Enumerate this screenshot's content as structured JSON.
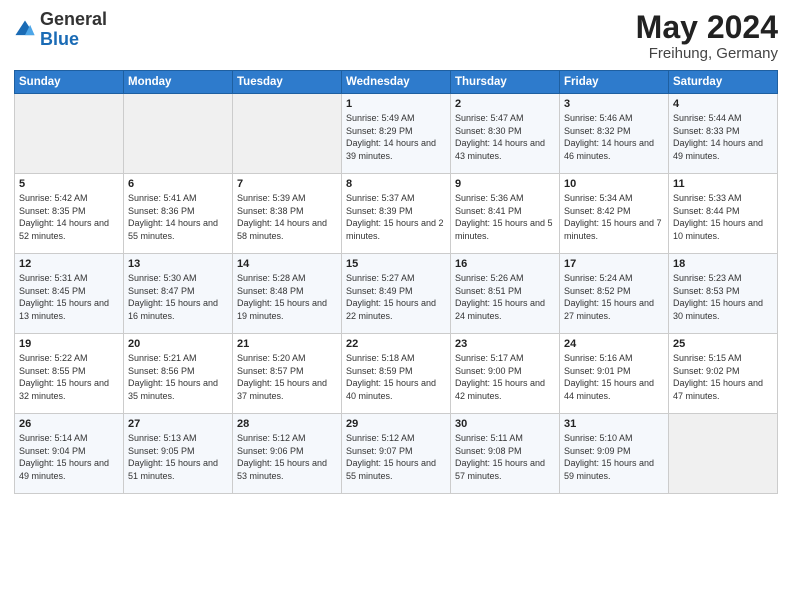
{
  "header": {
    "logo_general": "General",
    "logo_blue": "Blue",
    "title": "May 2024",
    "subtitle": "Freihung, Germany"
  },
  "days_of_week": [
    "Sunday",
    "Monday",
    "Tuesday",
    "Wednesday",
    "Thursday",
    "Friday",
    "Saturday"
  ],
  "weeks": [
    [
      {
        "day": "",
        "empty": true
      },
      {
        "day": "",
        "empty": true
      },
      {
        "day": "",
        "empty": true
      },
      {
        "day": "1",
        "sunrise": "5:49 AM",
        "sunset": "8:29 PM",
        "daylight": "14 hours and 39 minutes."
      },
      {
        "day": "2",
        "sunrise": "5:47 AM",
        "sunset": "8:30 PM",
        "daylight": "14 hours and 43 minutes."
      },
      {
        "day": "3",
        "sunrise": "5:46 AM",
        "sunset": "8:32 PM",
        "daylight": "14 hours and 46 minutes."
      },
      {
        "day": "4",
        "sunrise": "5:44 AM",
        "sunset": "8:33 PM",
        "daylight": "14 hours and 49 minutes."
      }
    ],
    [
      {
        "day": "5",
        "sunrise": "5:42 AM",
        "sunset": "8:35 PM",
        "daylight": "14 hours and 52 minutes."
      },
      {
        "day": "6",
        "sunrise": "5:41 AM",
        "sunset": "8:36 PM",
        "daylight": "14 hours and 55 minutes."
      },
      {
        "day": "7",
        "sunrise": "5:39 AM",
        "sunset": "8:38 PM",
        "daylight": "14 hours and 58 minutes."
      },
      {
        "day": "8",
        "sunrise": "5:37 AM",
        "sunset": "8:39 PM",
        "daylight": "15 hours and 2 minutes."
      },
      {
        "day": "9",
        "sunrise": "5:36 AM",
        "sunset": "8:41 PM",
        "daylight": "15 hours and 5 minutes."
      },
      {
        "day": "10",
        "sunrise": "5:34 AM",
        "sunset": "8:42 PM",
        "daylight": "15 hours and 7 minutes."
      },
      {
        "day": "11",
        "sunrise": "5:33 AM",
        "sunset": "8:44 PM",
        "daylight": "15 hours and 10 minutes."
      }
    ],
    [
      {
        "day": "12",
        "sunrise": "5:31 AM",
        "sunset": "8:45 PM",
        "daylight": "15 hours and 13 minutes."
      },
      {
        "day": "13",
        "sunrise": "5:30 AM",
        "sunset": "8:47 PM",
        "daylight": "15 hours and 16 minutes."
      },
      {
        "day": "14",
        "sunrise": "5:28 AM",
        "sunset": "8:48 PM",
        "daylight": "15 hours and 19 minutes."
      },
      {
        "day": "15",
        "sunrise": "5:27 AM",
        "sunset": "8:49 PM",
        "daylight": "15 hours and 22 minutes."
      },
      {
        "day": "16",
        "sunrise": "5:26 AM",
        "sunset": "8:51 PM",
        "daylight": "15 hours and 24 minutes."
      },
      {
        "day": "17",
        "sunrise": "5:24 AM",
        "sunset": "8:52 PM",
        "daylight": "15 hours and 27 minutes."
      },
      {
        "day": "18",
        "sunrise": "5:23 AM",
        "sunset": "8:53 PM",
        "daylight": "15 hours and 30 minutes."
      }
    ],
    [
      {
        "day": "19",
        "sunrise": "5:22 AM",
        "sunset": "8:55 PM",
        "daylight": "15 hours and 32 minutes."
      },
      {
        "day": "20",
        "sunrise": "5:21 AM",
        "sunset": "8:56 PM",
        "daylight": "15 hours and 35 minutes."
      },
      {
        "day": "21",
        "sunrise": "5:20 AM",
        "sunset": "8:57 PM",
        "daylight": "15 hours and 37 minutes."
      },
      {
        "day": "22",
        "sunrise": "5:18 AM",
        "sunset": "8:59 PM",
        "daylight": "15 hours and 40 minutes."
      },
      {
        "day": "23",
        "sunrise": "5:17 AM",
        "sunset": "9:00 PM",
        "daylight": "15 hours and 42 minutes."
      },
      {
        "day": "24",
        "sunrise": "5:16 AM",
        "sunset": "9:01 PM",
        "daylight": "15 hours and 44 minutes."
      },
      {
        "day": "25",
        "sunrise": "5:15 AM",
        "sunset": "9:02 PM",
        "daylight": "15 hours and 47 minutes."
      }
    ],
    [
      {
        "day": "26",
        "sunrise": "5:14 AM",
        "sunset": "9:04 PM",
        "daylight": "15 hours and 49 minutes."
      },
      {
        "day": "27",
        "sunrise": "5:13 AM",
        "sunset": "9:05 PM",
        "daylight": "15 hours and 51 minutes."
      },
      {
        "day": "28",
        "sunrise": "5:12 AM",
        "sunset": "9:06 PM",
        "daylight": "15 hours and 53 minutes."
      },
      {
        "day": "29",
        "sunrise": "5:12 AM",
        "sunset": "9:07 PM",
        "daylight": "15 hours and 55 minutes."
      },
      {
        "day": "30",
        "sunrise": "5:11 AM",
        "sunset": "9:08 PM",
        "daylight": "15 hours and 57 minutes."
      },
      {
        "day": "31",
        "sunrise": "5:10 AM",
        "sunset": "9:09 PM",
        "daylight": "15 hours and 59 minutes."
      },
      {
        "day": "",
        "empty": true
      }
    ]
  ],
  "labels": {
    "sunrise": "Sunrise:",
    "sunset": "Sunset:",
    "daylight": "Daylight:"
  }
}
